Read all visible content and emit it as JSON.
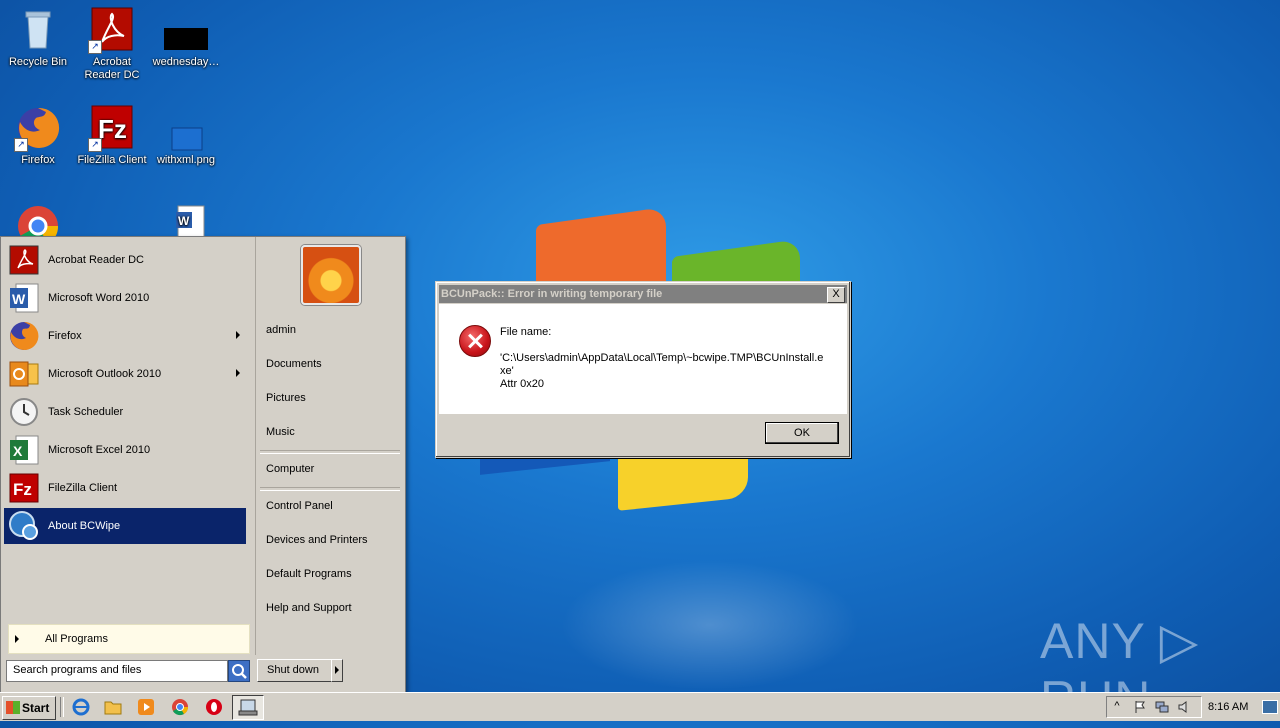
{
  "desktop": {
    "icons": [
      {
        "label": "Recycle Bin"
      },
      {
        "label": "Acrobat\nReader DC"
      },
      {
        "label": "wednesday…"
      },
      {
        "label": "Firefox"
      },
      {
        "label": "FileZilla Client"
      },
      {
        "label": "withxml.png"
      }
    ]
  },
  "start_menu": {
    "programs": [
      {
        "label": "Acrobat Reader DC"
      },
      {
        "label": "Microsoft Word 2010"
      },
      {
        "label": "Firefox"
      },
      {
        "label": "Microsoft Outlook 2010"
      },
      {
        "label": "Task Scheduler"
      },
      {
        "label": "Microsoft Excel 2010"
      },
      {
        "label": "FileZilla Client"
      },
      {
        "label": "About BCWipe"
      }
    ],
    "all_programs": "All Programs",
    "search_placeholder": "Search programs and files",
    "right": {
      "user": "admin",
      "documents": "Documents",
      "pictures": "Pictures",
      "music": "Music",
      "computer": "Computer",
      "control_panel": "Control Panel",
      "devices": "Devices and Printers",
      "default_programs": "Default Programs",
      "help": "Help and Support"
    },
    "shutdown": "Shut down"
  },
  "dialog": {
    "title": "BCUnPack:: Error in writing temporary file",
    "close": "X",
    "line1": "File name:",
    "line2": "'C:\\Users\\admin\\AppData\\Local\\Temp\\~bcwipe.TMP\\BCUnInstall.e",
    "line3": "xe'",
    "line4": "Attr 0x20",
    "ok": "OK"
  },
  "taskbar": {
    "start": "Start",
    "clock": "8:16 AM",
    "tray_expand": "^"
  },
  "watermark": "ANY ▷ RUN"
}
